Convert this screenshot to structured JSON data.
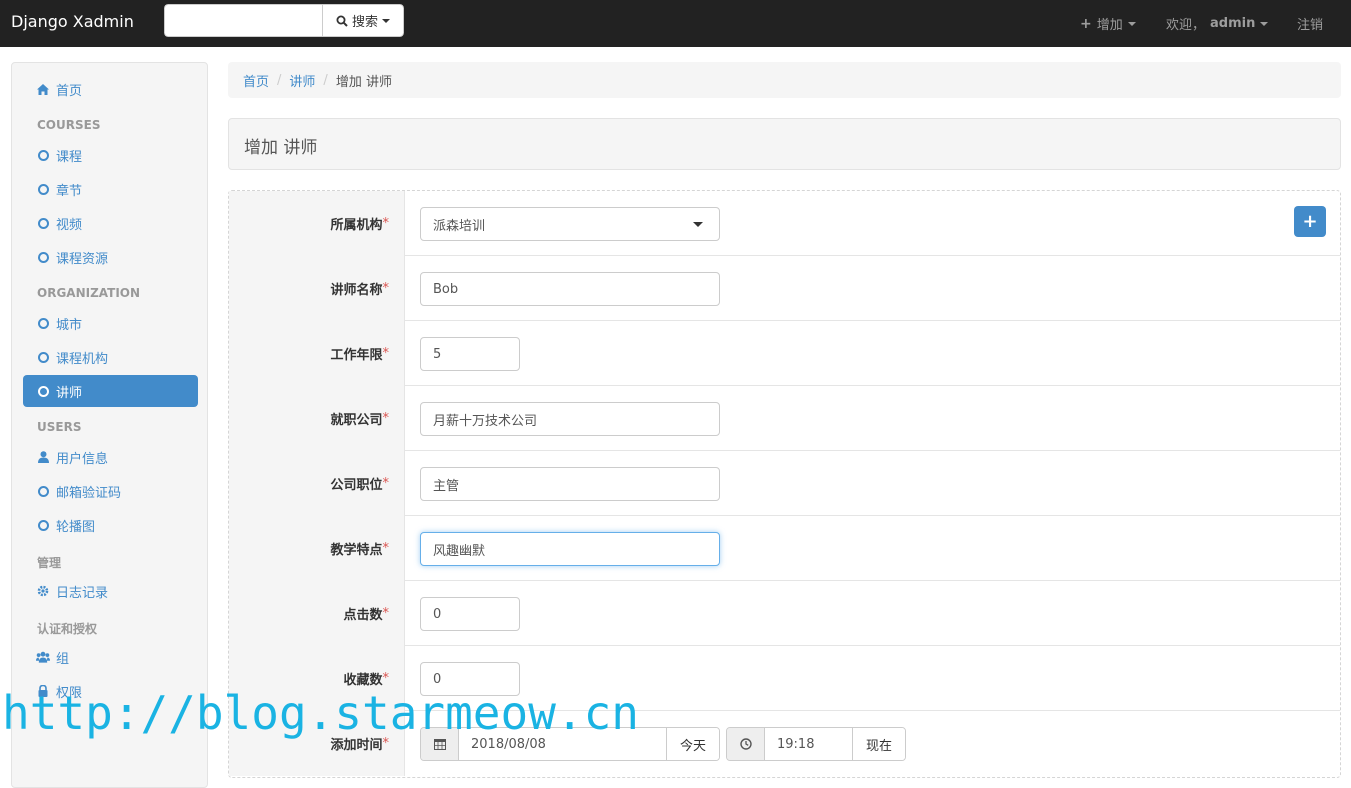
{
  "navbar": {
    "brand": "Django Xadmin",
    "search_placeholder": "",
    "search_button": "搜索",
    "add_label": "增加",
    "welcome_label": "欢迎，",
    "user_name": "admin",
    "logout_label": "注销"
  },
  "sidebar": {
    "home": "首页",
    "sections": {
      "courses": "COURSES",
      "organization": "ORGANIZATION",
      "users": "USERS",
      "manage": "管理",
      "auth": "认证和授权"
    },
    "items": {
      "course": "课程",
      "chapter": "章节",
      "video": "视频",
      "course_resource": "课程资源",
      "city": "城市",
      "course_org": "课程机构",
      "teacher": "讲师",
      "user_info": "用户信息",
      "email_code": "邮箱验证码",
      "banner": "轮播图",
      "log": "日志记录",
      "group": "组",
      "permission": "权限"
    },
    "active_item": "teacher"
  },
  "breadcrumb": {
    "home": "首页",
    "teacher": "讲师",
    "current": "增加 讲师"
  },
  "page": {
    "title": "增加 讲师"
  },
  "form": {
    "org": {
      "label": "所属机构",
      "value": "派森培训"
    },
    "name": {
      "label": "讲师名称",
      "value": "Bob"
    },
    "work_years": {
      "label": "工作年限",
      "value": "5"
    },
    "work_company": {
      "label": "就职公司",
      "value": "月薪十万技术公司"
    },
    "work_position": {
      "label": "公司职位",
      "value": "主管"
    },
    "points": {
      "label": "教学特点",
      "value": "风趣幽默"
    },
    "click_nums": {
      "label": "点击数",
      "value": "0"
    },
    "fav_nums": {
      "label": "收藏数",
      "value": "0"
    },
    "add_time": {
      "label": "添加时间",
      "date": "2018/08/08",
      "today_button": "今天",
      "time": "19:18",
      "now_button": "现在"
    },
    "required_mark": "*"
  },
  "watermark": "http://blog.starmeow.cn",
  "colors": {
    "primary": "#428bca",
    "navbar": "#222222",
    "required": "#d9534f",
    "watermark": "#1ab3e3"
  }
}
